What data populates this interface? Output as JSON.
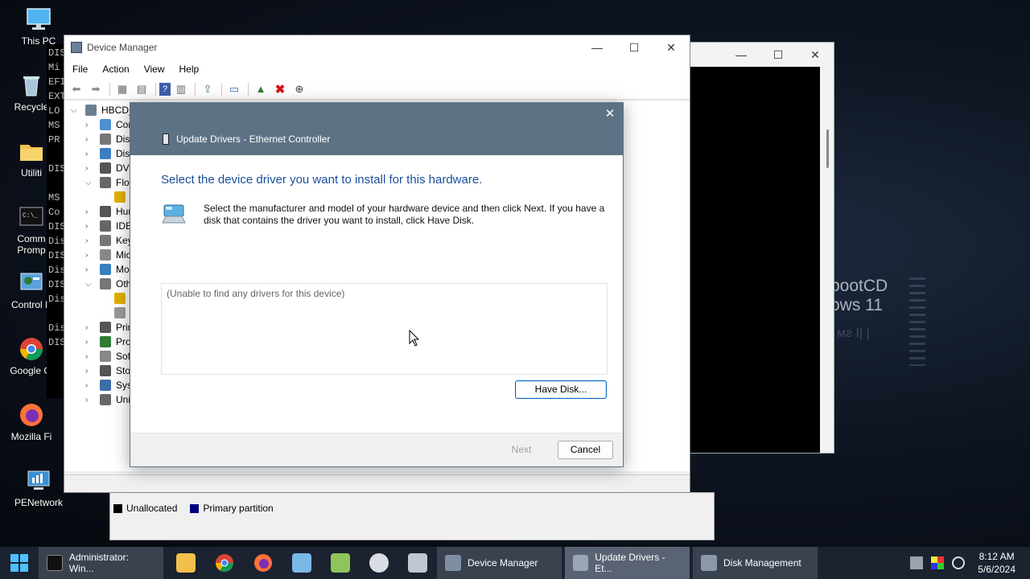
{
  "desktop": {
    "icons": [
      {
        "label": "This PC"
      },
      {
        "label": "Recycle"
      },
      {
        "label": "Utiliti"
      },
      {
        "label": "Comm\nPromp"
      },
      {
        "label": "Control P"
      },
      {
        "label": "Google Cl"
      },
      {
        "label": "Mozilla Fi"
      },
      {
        "label": "PENetwork"
      }
    ],
    "wallpaper_line1": "bootCD",
    "wallpaper_line2": "ows 11",
    "console_lines": [
      "DIS",
      "Mi",
      "EFI",
      "EXT",
      "LO",
      "MS",
      "PR",
      "",
      "DIS",
      "",
      "MS",
      "Co",
      "DIS",
      "Dis",
      "DIS",
      "Dis",
      "DIS",
      "Dis",
      "",
      "Dis",
      "DIS"
    ]
  },
  "device_manager": {
    "title": "Device Manager",
    "menu": [
      "File",
      "Action",
      "View",
      "Help"
    ],
    "tree_root": "HBCD_",
    "tree_items": [
      "Cor",
      "Disl",
      "Disp",
      "DVD",
      "Flop",
      "",
      "Hur",
      "IDE",
      "Key",
      "Mic",
      "Mo",
      "Oth",
      "",
      "",
      "Prir",
      "Pro",
      "Soft",
      "Stor",
      "Syst",
      "Uni"
    ]
  },
  "disk_management": {
    "legend": [
      {
        "label": "Unallocated",
        "color": "#000000"
      },
      {
        "label": "Primary partition",
        "color": "#000080"
      }
    ]
  },
  "dialog": {
    "title": "Update Drivers - Ethernet Controller",
    "heading": "Select the device driver you want to install for this hardware.",
    "description": "Select the manufacturer and model of your hardware device and then click Next. If you have a disk that contains the driver you want to install, click Have Disk.",
    "list_empty": "(Unable to find any drivers for this device)",
    "have_disk_label": "Have Disk...",
    "next_label": "Next",
    "cancel_label": "Cancel",
    "close_glyph": "✕"
  },
  "taskbar": {
    "apps": [
      {
        "label": "Administrator: Win...",
        "color": "#1e1e1e"
      },
      {
        "label": "Device Manager",
        "color": "#7f8fa3"
      },
      {
        "label": "Update Drivers - Et...",
        "color": "#9aa6b3"
      },
      {
        "label": "Disk Management",
        "color": "#8a98a8"
      }
    ],
    "time": "8:12 AM",
    "date": "5/6/2024"
  },
  "colors": {
    "dialog_header": "#5d7385",
    "heading_blue": "#1a4f9c",
    "taskbar": "#1b2230"
  }
}
